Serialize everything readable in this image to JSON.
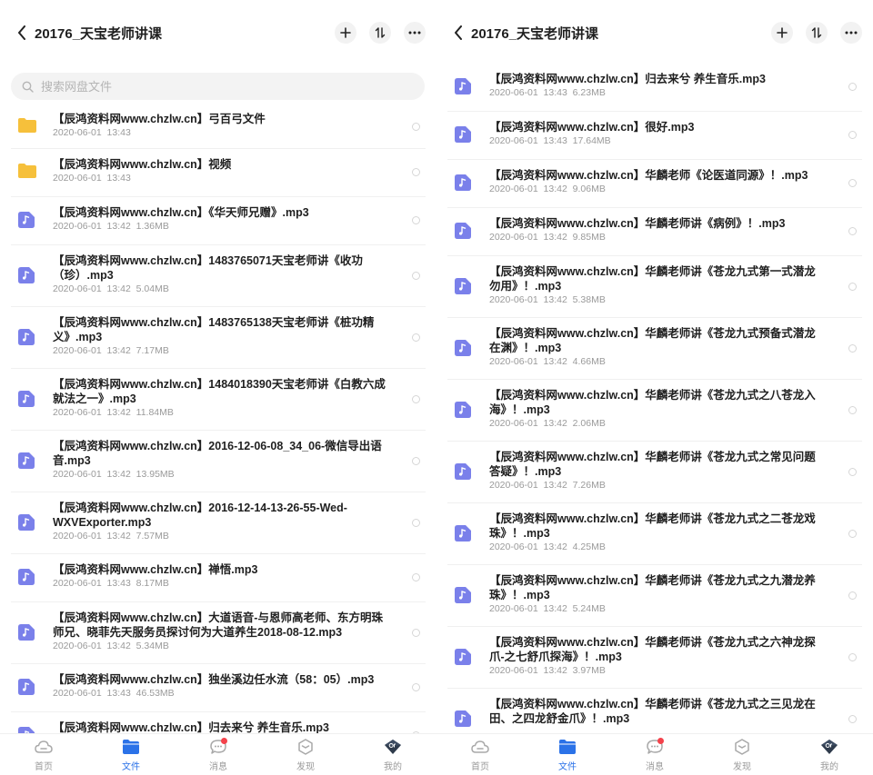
{
  "left": {
    "title": "20176_天宝老师讲课",
    "search_placeholder": "搜索网盘文件",
    "items": [
      {
        "type": "folder",
        "name": "【辰鸿资料网www.chzlw.cn】弓百弓文件",
        "date": "2020-06-01",
        "time": "13:43",
        "size": ""
      },
      {
        "type": "folder",
        "name": "【辰鸿资料网www.chzlw.cn】视频",
        "date": "2020-06-01",
        "time": "13:43",
        "size": ""
      },
      {
        "type": "audio",
        "name": "【辰鸿资料网www.chzlw.cn】《华天师兄赠》.mp3",
        "date": "2020-06-01",
        "time": "13:42",
        "size": "1.36MB"
      },
      {
        "type": "audio",
        "name": "【辰鸿资料网www.chzlw.cn】1483765071天宝老师讲《收功（珍）.mp3",
        "date": "2020-06-01",
        "time": "13:42",
        "size": "5.04MB"
      },
      {
        "type": "audio",
        "name": "【辰鸿资料网www.chzlw.cn】1483765138天宝老师讲《桩功精义》.mp3",
        "date": "2020-06-01",
        "time": "13:42",
        "size": "7.17MB"
      },
      {
        "type": "audio",
        "name": "【辰鸿资料网www.chzlw.cn】1484018390天宝老师讲《白教六成就法之一》.mp3",
        "date": "2020-06-01",
        "time": "13:42",
        "size": "11.84MB"
      },
      {
        "type": "audio",
        "name": "【辰鸿资料网www.chzlw.cn】2016-12-06-08_34_06-微信导出语音.mp3",
        "date": "2020-06-01",
        "time": "13:42",
        "size": "13.95MB"
      },
      {
        "type": "audio",
        "name": "【辰鸿资料网www.chzlw.cn】2016-12-14-13-26-55-Wed-WXVExporter.mp3",
        "date": "2020-06-01",
        "time": "13:42",
        "size": "7.57MB"
      },
      {
        "type": "audio",
        "name": "【辰鸿资料网www.chzlw.cn】禅悟.mp3",
        "date": "2020-06-01",
        "time": "13:43",
        "size": "8.17MB"
      },
      {
        "type": "audio",
        "name": "【辰鸿资料网www.chzlw.cn】大道语音-与恩师高老师、东方明珠师兄、晓菲先天服务员探讨何为大道养生2018-08-12.mp3",
        "date": "2020-06-01",
        "time": "13:42",
        "size": "5.34MB"
      },
      {
        "type": "audio",
        "name": "【辰鸿资料网www.chzlw.cn】独坐溪边任水流（58：05）.mp3",
        "date": "2020-06-01",
        "time": "13:43",
        "size": "46.53MB"
      },
      {
        "type": "audio",
        "name": "【辰鸿资料网www.chzlw.cn】归去来兮 养生音乐.mp3",
        "date": "",
        "time": "",
        "size": ""
      }
    ]
  },
  "right": {
    "title": "20176_天宝老师讲课",
    "items": [
      {
        "type": "audio",
        "name": "【辰鸿资料网www.chzlw.cn】归去来兮 养生音乐.mp3",
        "date": "2020-06-01",
        "time": "13:43",
        "size": "6.23MB"
      },
      {
        "type": "audio",
        "name": "【辰鸿资料网www.chzlw.cn】很好.mp3",
        "date": "2020-06-01",
        "time": "13:43",
        "size": "17.64MB"
      },
      {
        "type": "audio",
        "name": "【辰鸿资料网www.chzlw.cn】华麟老师《论医道同源》！.mp3",
        "date": "2020-06-01",
        "time": "13:42",
        "size": "9.06MB"
      },
      {
        "type": "audio",
        "name": "【辰鸿资料网www.chzlw.cn】华麟老师讲《病例》！.mp3",
        "date": "2020-06-01",
        "time": "13:42",
        "size": "9.85MB"
      },
      {
        "type": "audio",
        "name": "【辰鸿资料网www.chzlw.cn】华麟老师讲《苍龙九式第一式潜龙勿用》！.mp3",
        "date": "2020-06-01",
        "time": "13:42",
        "size": "5.38MB"
      },
      {
        "type": "audio",
        "name": "【辰鸿资料网www.chzlw.cn】华麟老师讲《苍龙九式预备式潜龙在渊》！.mp3",
        "date": "2020-06-01",
        "time": "13:42",
        "size": "4.66MB"
      },
      {
        "type": "audio",
        "name": "【辰鸿资料网www.chzlw.cn】华麟老师讲《苍龙九式之八苍龙入海》！.mp3",
        "date": "2020-06-01",
        "time": "13:42",
        "size": "2.06MB"
      },
      {
        "type": "audio",
        "name": "【辰鸿资料网www.chzlw.cn】华麟老师讲《苍龙九式之常见问题答疑》！.mp3",
        "date": "2020-06-01",
        "time": "13:42",
        "size": "7.26MB"
      },
      {
        "type": "audio",
        "name": "【辰鸿资料网www.chzlw.cn】华麟老师讲《苍龙九式之二苍龙戏珠》！.mp3",
        "date": "2020-06-01",
        "time": "13:42",
        "size": "4.25MB"
      },
      {
        "type": "audio",
        "name": "【辰鸿资料网www.chzlw.cn】华麟老师讲《苍龙九式之九潜龙养珠》！.mp3",
        "date": "2020-06-01",
        "time": "13:42",
        "size": "5.24MB"
      },
      {
        "type": "audio",
        "name": "【辰鸿资料网www.chzlw.cn】华麟老师讲《苍龙九式之六神龙探爪-之七舒爪探海》！.mp3",
        "date": "2020-06-01",
        "time": "13:42",
        "size": "3.97MB"
      },
      {
        "type": "audio",
        "name": "【辰鸿资料网www.chzlw.cn】华麟老师讲《苍龙九式之三见龙在田、之四龙舒金爪》！.mp3",
        "date": "",
        "time": "",
        "size": ""
      }
    ]
  },
  "tabs": [
    {
      "label": "首页",
      "icon": "cloud-icon",
      "active": false,
      "dot": false
    },
    {
      "label": "文件",
      "icon": "folder-icon",
      "active": true,
      "dot": false
    },
    {
      "label": "消息",
      "icon": "chat-icon",
      "active": false,
      "dot": true
    },
    {
      "label": "发现",
      "icon": "discover-icon",
      "active": false,
      "dot": false
    },
    {
      "label": "我的",
      "icon": "avatar-icon",
      "active": false,
      "dot": false
    }
  ],
  "colors": {
    "accent": "#2b72e8",
    "folder": "#f6c03b",
    "audio": "#7a80ea",
    "badge": "#f4424b"
  }
}
